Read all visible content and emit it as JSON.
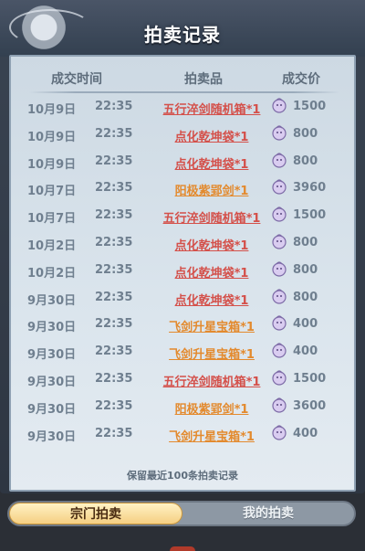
{
  "header": {
    "title": "拍卖记录"
  },
  "columns": {
    "time": "成交时间",
    "item": "拍卖品",
    "price": "成交价"
  },
  "records": [
    {
      "date": "10月9日",
      "time": "22:35",
      "item": "五行淬剑随机箱*1",
      "color": "red",
      "price": "1500"
    },
    {
      "date": "10月9日",
      "time": "22:35",
      "item": "点化乾坤袋*1",
      "color": "red",
      "price": "800"
    },
    {
      "date": "10月9日",
      "time": "22:35",
      "item": "点化乾坤袋*1",
      "color": "red",
      "price": "800"
    },
    {
      "date": "10月7日",
      "time": "22:35",
      "item": "阳极紫郢剑*1",
      "color": "orange",
      "price": "3960"
    },
    {
      "date": "10月7日",
      "time": "22:35",
      "item": "五行淬剑随机箱*1",
      "color": "red",
      "price": "1500"
    },
    {
      "date": "10月2日",
      "time": "22:35",
      "item": "点化乾坤袋*1",
      "color": "red",
      "price": "800"
    },
    {
      "date": "10月2日",
      "time": "22:35",
      "item": "点化乾坤袋*1",
      "color": "red",
      "price": "800"
    },
    {
      "date": "9月30日",
      "time": "22:35",
      "item": "点化乾坤袋*1",
      "color": "red",
      "price": "800"
    },
    {
      "date": "9月30日",
      "time": "22:35",
      "item": "飞剑升星宝箱*1",
      "color": "orange",
      "price": "400"
    },
    {
      "date": "9月30日",
      "time": "22:35",
      "item": "飞剑升星宝箱*1",
      "color": "orange",
      "price": "400"
    },
    {
      "date": "9月30日",
      "time": "22:35",
      "item": "五行淬剑随机箱*1",
      "color": "red",
      "price": "1500"
    },
    {
      "date": "9月30日",
      "time": "22:35",
      "item": "阳极紫郢剑*1",
      "color": "orange",
      "price": "3600"
    },
    {
      "date": "9月30日",
      "time": "22:35",
      "item": "飞剑升星宝箱*1",
      "color": "orange",
      "price": "400"
    }
  ],
  "footnote": "保留最近100条拍卖记录",
  "tabs": {
    "sect": "宗门拍卖",
    "mine": "我的拍卖"
  },
  "colors": {
    "red": "#d4504a",
    "orange": "#e38a2e",
    "coin": "#c9b6e8"
  },
  "icons": {
    "currency": "spirit-coin-icon"
  }
}
